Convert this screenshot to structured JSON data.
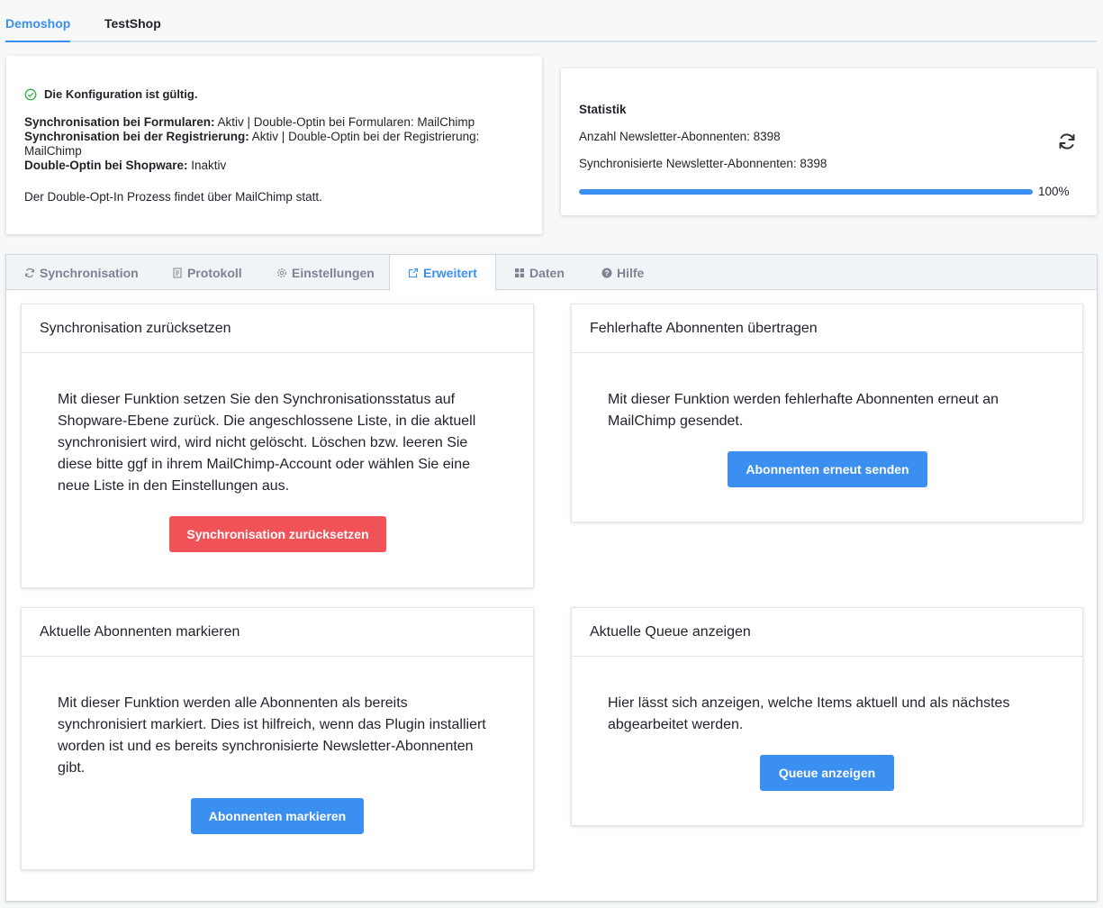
{
  "shop_tabs": [
    {
      "label": "Demoshop",
      "active": true
    },
    {
      "label": "TestShop",
      "active": false
    }
  ],
  "config": {
    "status_text": "Die Konfiguration ist gültig.",
    "lines": [
      {
        "label": "Synchronisation bei Formularen:",
        "value": " Aktiv | Double-Optin bei Formularen: MailChimp"
      },
      {
        "label": "Synchronisation bei der Registrierung:",
        "value": " Aktiv | Double-Optin bei der Registrierung: MailChimp"
      },
      {
        "label": "Double-Optin bei Shopware:",
        "value": " Inaktiv"
      }
    ],
    "note": "Der Double-Opt-In Prozess findet über MailChimp statt."
  },
  "stats": {
    "title": "Statistik",
    "subscribers_text": "Anzahl Newsletter-Abonnenten: 8398",
    "synced_text": "Synchronisierte Newsletter-Abonnenten: 8398",
    "progress_percent": 100,
    "progress_label": "100%"
  },
  "tabs": [
    {
      "label": "Synchronisation",
      "icon": "sync-icon",
      "active": false
    },
    {
      "label": "Protokoll",
      "icon": "document-icon",
      "active": false
    },
    {
      "label": "Einstellungen",
      "icon": "gear-icon",
      "active": false
    },
    {
      "label": "Erweitert",
      "icon": "external-link-icon",
      "active": true
    },
    {
      "label": "Daten",
      "icon": "grid-icon",
      "active": false
    },
    {
      "label": "Hilfe",
      "icon": "help-icon",
      "active": false
    }
  ],
  "boxes": {
    "reset": {
      "title": "Synchronisation zurücksetzen",
      "text": "Mit dieser Funktion setzen Sie den Synchronisationsstatus auf Shopware-Ebene zurück. Die angeschlossene Liste, in die aktuell synchronisiert wird, wird nicht gelöscht. Löschen bzw. leeren Sie diese bitte ggf in ihrem MailChimp-Account oder wählen Sie eine neue Liste in den Einstellungen aus.",
      "button": "Synchronisation zurücksetzen"
    },
    "resend": {
      "title": "Fehlerhafte Abonnenten übertragen",
      "text": "Mit dieser Funktion werden fehlerhafte Abonnenten erneut an MailChimp gesendet.",
      "button": "Abonnenten erneut senden"
    },
    "mark": {
      "title": "Aktuelle Abonnenten markieren",
      "text": "Mit dieser Funktion werden alle Abonnenten als bereits synchronisiert markiert. Dies ist hilfreich, wenn das Plugin installiert worden ist und es bereits synchronisierte Newsletter-Abonnenten gibt.",
      "button": "Abonnenten markieren"
    },
    "queue": {
      "title": "Aktuelle Queue anzeigen",
      "text": "Hier lässt sich anzeigen, welche Items aktuell und als nächstes abgearbeitet werden.",
      "button": "Queue anzeigen"
    }
  },
  "colors": {
    "accent": "#3b8ff0",
    "danger": "#f05258",
    "success": "#2fb344"
  }
}
